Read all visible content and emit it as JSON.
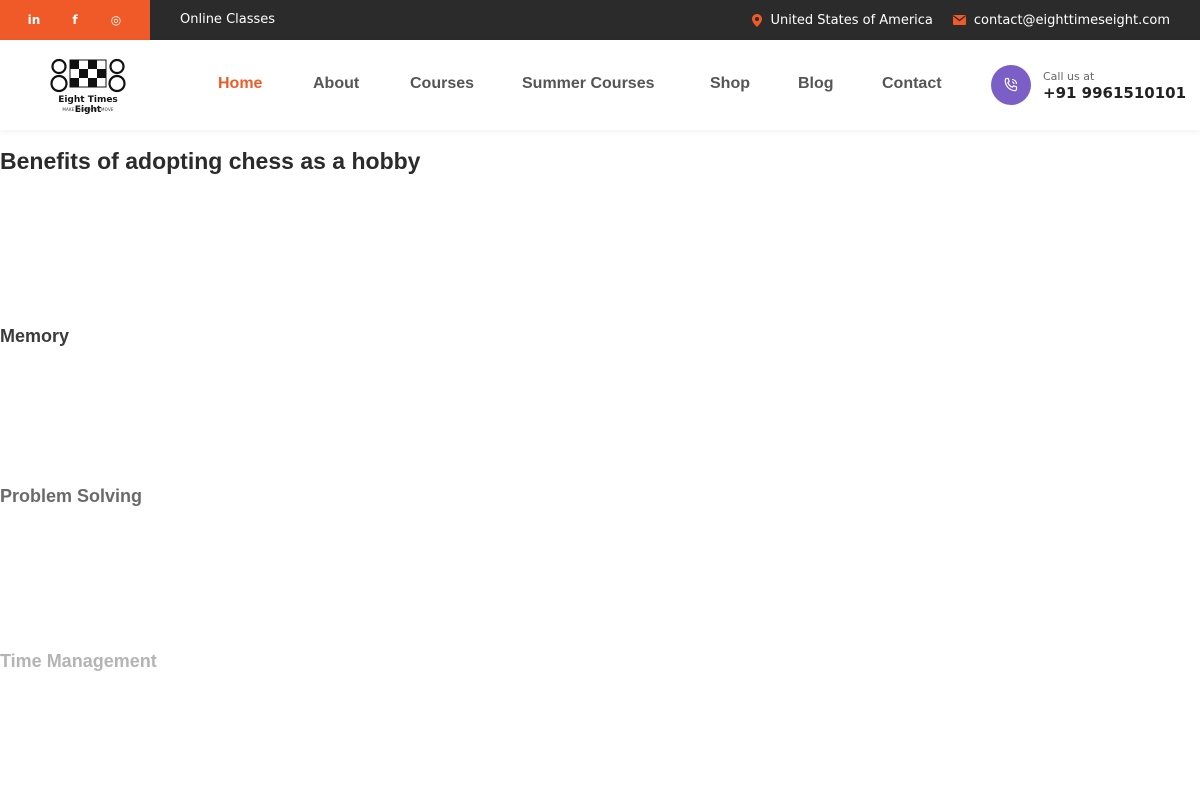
{
  "topbar": {
    "social_icons": [
      "linkedin-icon",
      "facebook-icon",
      "instagram-icon"
    ],
    "social_glyphs": {
      "linkedin": "in",
      "facebook": "f",
      "instagram": "◎"
    },
    "online_classes": "Online Classes",
    "location": "United States of America",
    "email": "contact@eighttimeseight.com"
  },
  "header": {
    "logo": {
      "name": "Eight Times Eight",
      "tagline": "MAKE THE RIGHT MOVE"
    },
    "nav": [
      "Home",
      "About",
      "Courses",
      "Summer Courses",
      "Shop",
      "Blog",
      "Contact"
    ],
    "active_nav": "Home",
    "call": {
      "label": "Call us at",
      "number": "+91 9961510101"
    }
  },
  "content": {
    "heading": "Benefits of adopting chess as a hobby",
    "sections": [
      "Memory",
      "Problem Solving",
      "Time Management"
    ]
  },
  "colors": {
    "accent": "#f05a28",
    "topbar": "#2b2b2b",
    "call_icon": "#7b5fc7"
  }
}
